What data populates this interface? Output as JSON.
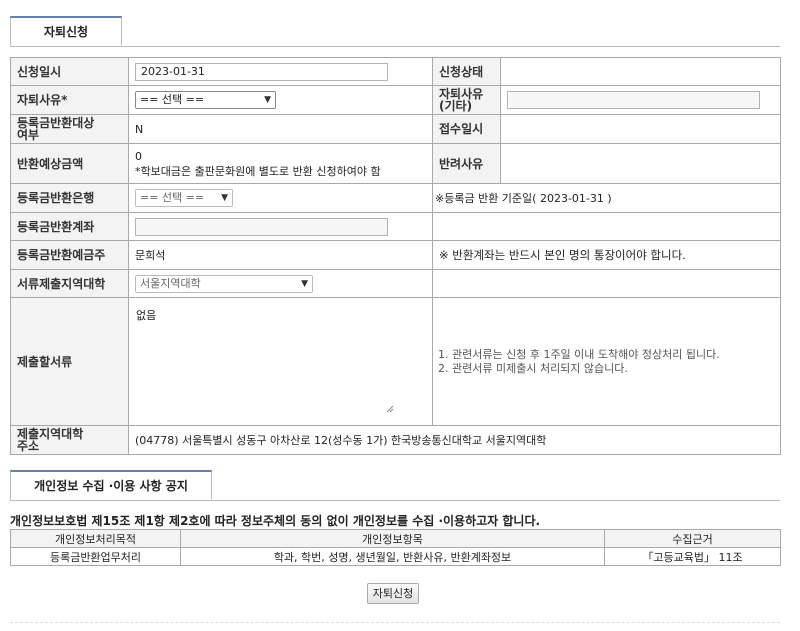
{
  "tab": {
    "title": "자퇴신청"
  },
  "form": {
    "apply_date": {
      "label": "신청일시",
      "value": "2023-01-31"
    },
    "apply_status": {
      "label": "신청상태",
      "value": ""
    },
    "reason": {
      "label": "자퇴사유*",
      "selected": "== 선택 =="
    },
    "reason_other": {
      "label1": "자퇴사유",
      "label2": "(기타)",
      "value": ""
    },
    "refund_target": {
      "label1": "등록금반환대상",
      "label2": "여부",
      "value": "N"
    },
    "received_at": {
      "label": "접수일시",
      "value": ""
    },
    "refund_amount": {
      "label": "반환예상금액",
      "value": "0",
      "note": "*학보대금은 출판문화원에 별도로 반환 신청하여야 함"
    },
    "reject_reason": {
      "label": "반려사유",
      "value": ""
    },
    "refund_bank": {
      "label": "등록금반환은행",
      "selected": "== 선택 ==",
      "note": "※등록금 반환 기준일( 2023-01-31 )"
    },
    "refund_account": {
      "label": "등록금반환계좌",
      "value": ""
    },
    "account_holder": {
      "label": "등록금반환예금주",
      "value": "문희석",
      "note": "※ 반환계좌는 반드시 본인 명의 통장이어야 합니다."
    },
    "region_college": {
      "label": "서류제출지역대학",
      "selected": "서울지역대학"
    },
    "documents": {
      "label": "제출할서류",
      "value": "없음",
      "note1": "1. 관련서류는 신청 후 1주일 이내 도착해야 정상처리 됩니다.",
      "note2": "2. 관련서류 미제출시 처리되지 않습니다."
    },
    "address": {
      "label1": "제출지역대학",
      "label2": "주소",
      "value": "(04778) 서울특별시 성동구 아차산로 12(성수동 1가) 한국방송통신대학교 서울지역대학"
    }
  },
  "privacy": {
    "tab_title": "개인정보 수집 ·이용 사항 공지",
    "notice": "개인정보보호법 제15조 제1항 제2호에 따라 정보주체의 동의 없이 개인정보를 수집 ·이용하고자 합니다.",
    "headers": [
      "개인정보처리목적",
      "개인정보항목",
      "수집근거"
    ],
    "row": [
      "등록금반환업무처리",
      "학과, 학번, 성명, 생년월일, 반환사유, 반환계좌정보",
      "「고등교육법」 11조"
    ]
  },
  "submit_label": "자퇴신청"
}
